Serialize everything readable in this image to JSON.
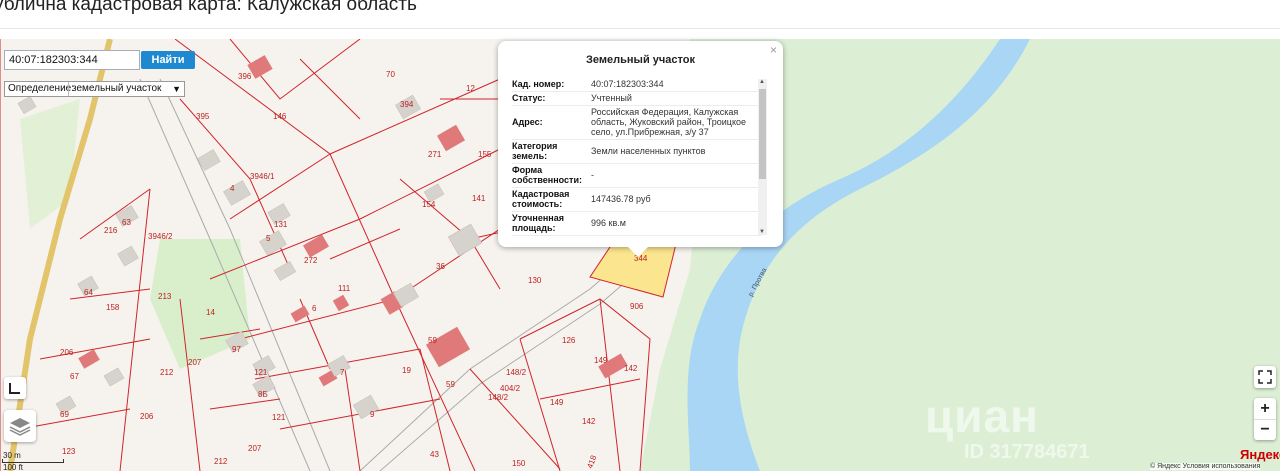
{
  "page": {
    "title": "ублична кадастровая карта: Калужская область"
  },
  "search": {
    "value": "40:07:182303:344",
    "button_label": "Найти",
    "definition_label": "Определение:",
    "definition_value": "земельный участок"
  },
  "popup": {
    "title": "Земельный участок",
    "rows": [
      {
        "key": "Кад. номер:",
        "value": "40:07:182303:344"
      },
      {
        "key": "Статус:",
        "value": "Учтенный"
      },
      {
        "key": "Адрес:",
        "value": "Российская Федерация, Калужская область, Жуковский район, Троицкое село, ул.Прибрежная, з/у 37"
      },
      {
        "key": "Категория земель:",
        "value": "Земли населенных пунктов"
      },
      {
        "key": "Форма собственности:",
        "value": "-"
      },
      {
        "key": "Кадастровая стоимость:",
        "value": "147436.78 руб"
      },
      {
        "key": "Уточненная площадь:",
        "value": "996 кв.м"
      }
    ]
  },
  "map": {
    "river_label": "р. Протва",
    "scale": {
      "metric": "30 m",
      "imperial": "100 ft"
    },
    "watermark": "циан",
    "watermark_id": "ID 317784671",
    "brand": "Яндекс",
    "footer": "© Яндекс  Условия использования",
    "parcel_labels": [
      "396",
      "70",
      "394",
      "12",
      "146",
      "395",
      "271",
      "155",
      "3946/1",
      "4",
      "154",
      "141",
      "131",
      "5",
      "272",
      "36",
      "130",
      "111",
      "63",
      "216",
      "3946/2",
      "64",
      "158",
      "213",
      "14",
      "6",
      "59",
      "906",
      "126",
      "206",
      "97",
      "207",
      "212",
      "121",
      "7",
      "19",
      "404/2",
      "148/2",
      "149",
      "148/2",
      "67",
      "69",
      "206",
      "8Б",
      "121",
      "9",
      "59",
      "142",
      "149",
      "142",
      "123",
      "207",
      "212",
      "43",
      "150",
      "418",
      "344"
    ]
  },
  "controls": {
    "fullscreen_icon": "fullscreen-icon",
    "zoom_in": "+",
    "zoom_out": "−",
    "ruler_icon": "ruler-icon",
    "layers_icon": "layers-icon"
  },
  "colors": {
    "river": "#a9d6f5",
    "forest": "#dcefd4",
    "parcel_border": "#d0242b",
    "building": "#e07a7a",
    "selected_parcel": "#fbe58f",
    "button": "#1e88d0"
  }
}
